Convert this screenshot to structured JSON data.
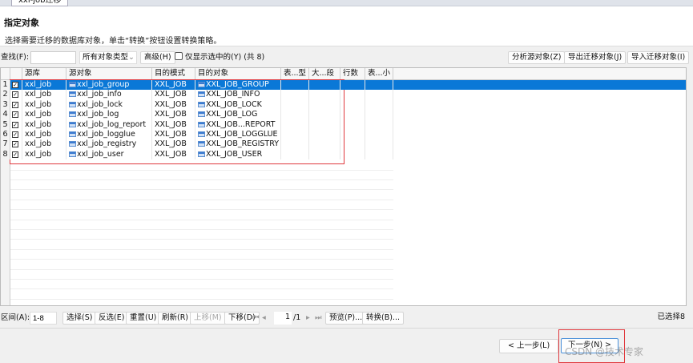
{
  "window": {
    "tab_title": "xxl-job迁移"
  },
  "header": {
    "title": "指定对象",
    "description": "选择需要迁移的数据库对象，单击“转换”按钮设置转换策略。"
  },
  "toolbar": {
    "find_label": "查找(F):",
    "find_value": "",
    "type_select": "所有对象类型",
    "advanced": "高级(H)",
    "only_selected": "仅显示选中的(Y)",
    "count": "(共 8)",
    "analyze": "分析源对象(Z)",
    "export": "导出迁移对象(J)",
    "import": "导入迁移对象(I)"
  },
  "table": {
    "columns": [
      "源库",
      "源对象",
      "目的模式",
      "目的对象",
      "表...型",
      "大...段",
      "行数",
      "表...小"
    ],
    "rows": [
      {
        "n": "1",
        "src_db": "xxl_job",
        "src_obj": "xxl_job_group",
        "schema": "XXL_JOB",
        "dest": "XXL_JOB_GROUP",
        "checked": true,
        "selected": true
      },
      {
        "n": "2",
        "src_db": "xxl_job",
        "src_obj": "xxl_job_info",
        "schema": "XXL_JOB",
        "dest": "XXL_JOB_INFO",
        "checked": true
      },
      {
        "n": "3",
        "src_db": "xxl_job",
        "src_obj": "xxl_job_lock",
        "schema": "XXL_JOB",
        "dest": "XXL_JOB_LOCK",
        "checked": true
      },
      {
        "n": "4",
        "src_db": "xxl_job",
        "src_obj": "xxl_job_log",
        "schema": "XXL_JOB",
        "dest": "XXL_JOB_LOG",
        "checked": true
      },
      {
        "n": "5",
        "src_db": "xxl_job",
        "src_obj": "xxl_job_log_report",
        "schema": "XXL_JOB",
        "dest": "XXL_JOB...REPORT",
        "checked": true
      },
      {
        "n": "6",
        "src_db": "xxl_job",
        "src_obj": "xxl_job_logglue",
        "schema": "XXL_JOB",
        "dest": "XXL_JOB_LOGGLUE",
        "checked": true
      },
      {
        "n": "7",
        "src_db": "xxl_job",
        "src_obj": "xxl_job_registry",
        "schema": "XXL_JOB",
        "dest": "XXL_JOB_REGISTRY",
        "checked": true
      },
      {
        "n": "8",
        "src_db": "xxl_job",
        "src_obj": "xxl_job_user",
        "schema": "XXL_JOB",
        "dest": "XXL_JOB_USER",
        "checked": true
      }
    ]
  },
  "bottom": {
    "range_label": "区间(A):",
    "range_value": "1-8",
    "select": "选择(S)",
    "invert": "反选(E)",
    "reset": "重置(U)",
    "refresh": "刷新(R)",
    "up": "上移(M)",
    "down": "下移(D)",
    "page": "1",
    "page_total": "/1",
    "preview": "预览(P)...",
    "convert": "转换(B)...",
    "selected_count": "已选择8"
  },
  "footer": {
    "prev": "< 上一步(L)",
    "next": "下一步(N) >",
    "watermark": "CSDN @技术专家"
  },
  "colors": {
    "selection": "#0a78d7",
    "highlight": "#e0393e"
  }
}
